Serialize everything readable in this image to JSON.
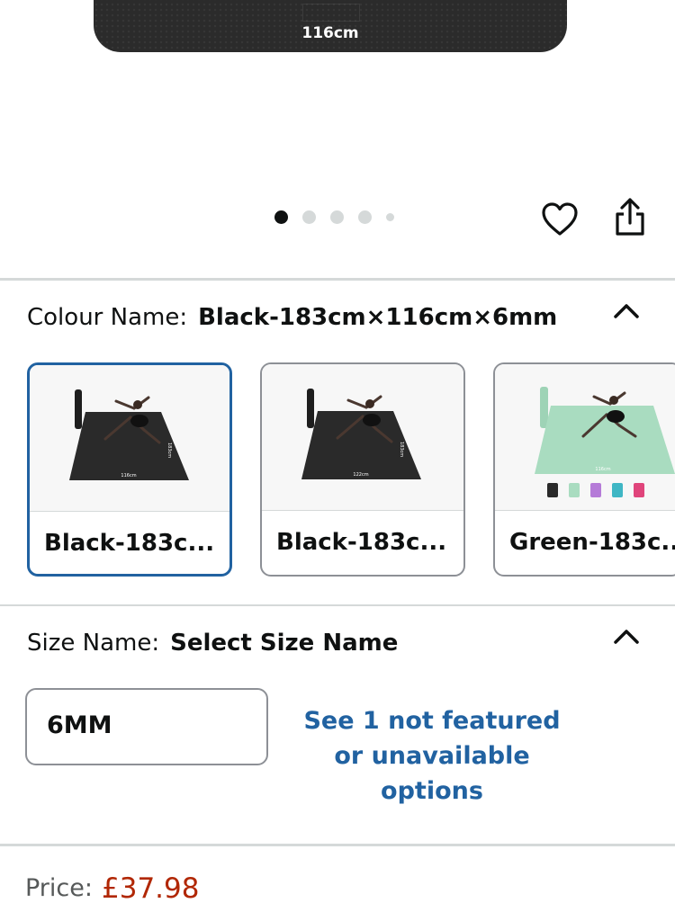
{
  "gallery": {
    "mat_width_label": "116cm",
    "page_count": 5,
    "active_page": 1
  },
  "colour": {
    "label": "Colour Name:",
    "selected_value": "Black-183cm×116cm×6mm",
    "options": [
      {
        "caption": "Black-183c...",
        "mat_color": "#2a2a2a",
        "width_label": "116cm",
        "side_label": "183cm",
        "selected": true
      },
      {
        "caption": "Black-183c...",
        "mat_color": "#2a2a2a",
        "width_label": "122cm",
        "side_label": "183cm",
        "selected": false
      },
      {
        "caption": "Green-183c...",
        "mat_color": "#a9dcc0",
        "width_label": "116cm",
        "side_label": "183cm",
        "selected": false
      }
    ]
  },
  "size": {
    "label": "Size Name:",
    "selected_value": "Select Size Name",
    "option": "6MM",
    "more_link": "See 1 not featured or unavailable options"
  },
  "price": {
    "label": "Price:",
    "value": "£37.98"
  },
  "colors": {
    "link": "#2162a1",
    "price": "#b12704",
    "selected_border": "#2162a1",
    "divider": "#d5d9d9"
  }
}
